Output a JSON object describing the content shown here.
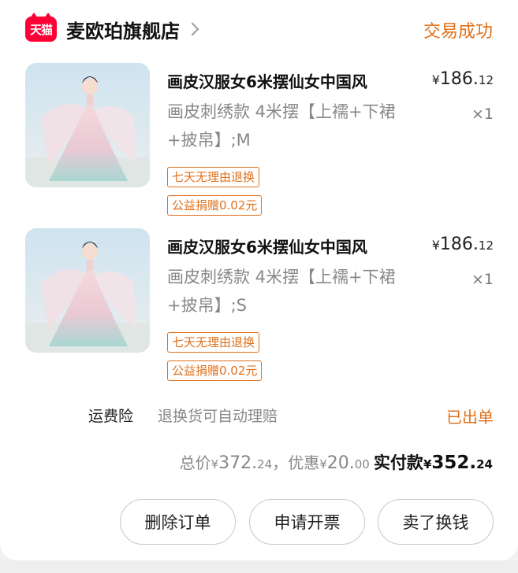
{
  "shop": {
    "badge": "天猫",
    "name": "麦欧珀旗舰店",
    "order_status": "交易成功"
  },
  "items": [
    {
      "title": "画皮汉服女6米摆仙女中国风",
      "spec": "画皮刺绣款 4米摆【上襦+下裙+披帛】;M",
      "price_currency": "¥",
      "price_int": "186.",
      "price_dec": "12",
      "qty": "×1",
      "tags": [
        "七天无理由退换",
        "公益捐赠0.02元"
      ]
    },
    {
      "title": "画皮汉服女6米摆仙女中国风",
      "spec": "画皮刺绣款 4米摆【上襦+下裙+披帛】;S",
      "price_currency": "¥",
      "price_int": "186.",
      "price_dec": "12",
      "qty": "×1",
      "tags": [
        "七天无理由退换",
        "公益捐赠0.02元"
      ]
    }
  ],
  "insurance": {
    "title": "运费险",
    "desc": "退换货可自动理赔",
    "status": "已出单"
  },
  "totals": {
    "total_label": "总价",
    "total_cur": "¥",
    "total_int": "372.",
    "total_dec": "24",
    "sep": "，",
    "discount_label": "优惠",
    "discount_cur": "¥",
    "discount_int": "20.",
    "discount_dec": "00",
    "paid_label": "实付款",
    "paid_cur": "¥",
    "paid_int": "352.",
    "paid_dec": "24"
  },
  "actions": {
    "delete": "删除订单",
    "invoice": "申请开票",
    "resell": "卖了换钱"
  },
  "colors": {
    "accent": "#e0701b",
    "tmall_red": "#ff0036"
  }
}
